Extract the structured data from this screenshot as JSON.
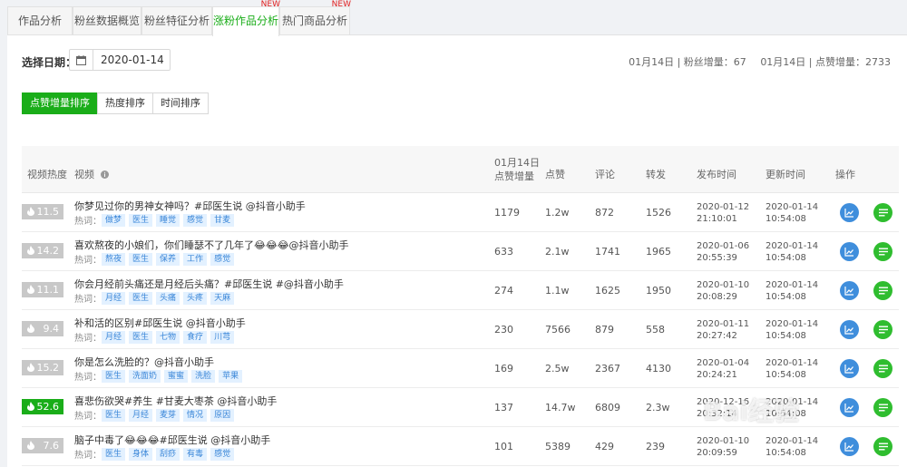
{
  "tabs": [
    {
      "label": "作品分析",
      "active": false,
      "badge": ""
    },
    {
      "label": "粉丝数据概览",
      "active": false,
      "badge": ""
    },
    {
      "label": "粉丝特征分析",
      "active": false,
      "badge": ""
    },
    {
      "label": "涨粉作品分析",
      "active": true,
      "badge": "NEW"
    },
    {
      "label": "热门商品分析",
      "active": false,
      "badge": "NEW"
    }
  ],
  "filter": {
    "date_label": "选择日期：",
    "date_value": "2020-01-14"
  },
  "stats": {
    "fans_gain": "01月14日 | 粉丝增量：67",
    "likes_gain": "01月14日 | 点赞增量：2733"
  },
  "sort_buttons": [
    {
      "label": "点赞增量排序",
      "active": true
    },
    {
      "label": "热度排序",
      "active": false
    },
    {
      "label": "时间排序",
      "active": false
    }
  ],
  "table": {
    "headers": {
      "heat": "视频热度",
      "video": "视频",
      "like_inc_date": "01月14日",
      "like_inc": "点赞增量",
      "likes": "点赞",
      "comments": "评论",
      "shares": "转发",
      "publish": "发布时间",
      "update": "更新时间",
      "ops": "操作"
    },
    "keyword_label": "热词：",
    "rows": [
      {
        "heat": "11.5",
        "hot": false,
        "title": "你梦见过你的男神女神吗？#邱医生说 @抖音小助手",
        "keywords": [
          "做梦",
          "医生",
          "睡觉",
          "感觉",
          "甘麦"
        ],
        "like_inc": "1179",
        "likes": "1.2w",
        "comments": "872",
        "shares": "1526",
        "publish_date": "2020-01-12",
        "publish_time": "21:10:01",
        "update_date": "2020-01-14",
        "update_time": "10:54:08"
      },
      {
        "heat": "14.2",
        "hot": false,
        "title": "喜欢熬夜的小娘们，你们睡瑟不了几年了😂😂😂@抖音小助手",
        "keywords": [
          "熬夜",
          "医生",
          "保养",
          "工作",
          "感觉"
        ],
        "like_inc": "633",
        "likes": "2.1w",
        "comments": "1741",
        "shares": "1965",
        "publish_date": "2020-01-06",
        "publish_time": "20:55:39",
        "update_date": "2020-01-14",
        "update_time": "10:54:08"
      },
      {
        "heat": "11.1",
        "hot": false,
        "title": "你会月经前头痛还是月经后头痛？#邱医生说 #@抖音小助手",
        "keywords": [
          "月经",
          "医生",
          "头痛",
          "头疼",
          "天麻"
        ],
        "like_inc": "274",
        "likes": "1.1w",
        "comments": "1625",
        "shares": "1950",
        "publish_date": "2020-01-10",
        "publish_time": "20:08:29",
        "update_date": "2020-01-14",
        "update_time": "10:54:08"
      },
      {
        "heat": "9.4",
        "hot": false,
        "title": "补和活的区别#邱医生说 @抖音小助手",
        "keywords": [
          "月经",
          "医生",
          "七物",
          "食疗",
          "川芎"
        ],
        "like_inc": "230",
        "likes": "7566",
        "comments": "879",
        "shares": "558",
        "publish_date": "2020-01-11",
        "publish_time": "20:27:42",
        "update_date": "2020-01-14",
        "update_time": "10:54:08"
      },
      {
        "heat": "15.2",
        "hot": false,
        "title": "你是怎么洗脸的？@抖音小助手",
        "keywords": [
          "医生",
          "洗面奶",
          "蜜蜜",
          "洗脸",
          "苹果"
        ],
        "like_inc": "169",
        "likes": "2.5w",
        "comments": "2367",
        "shares": "4130",
        "publish_date": "2020-01-04",
        "publish_time": "20:24:21",
        "update_date": "2020-01-14",
        "update_time": "10:54:08"
      },
      {
        "heat": "52.6",
        "hot": true,
        "title": "喜悲伤欲哭#养生 #甘麦大枣茶 @抖音小助手",
        "keywords": [
          "医生",
          "月经",
          "麦芽",
          "情况",
          "原因"
        ],
        "like_inc": "137",
        "likes": "14.7w",
        "comments": "6809",
        "shares": "2.3w",
        "publish_date": "2020-12-16",
        "publish_time": "20:32:14",
        "update_date": "2020-01-14",
        "update_time": "10:54:08"
      },
      {
        "heat": "7.6",
        "hot": false,
        "title": "脑子中毒了😂😂😂#邱医生说 @抖音小助手",
        "keywords": [
          "医生",
          "身体",
          "刮痧",
          "有毒",
          "感觉"
        ],
        "like_inc": "101",
        "likes": "5389",
        "comments": "429",
        "shares": "239",
        "publish_date": "2020-01-10",
        "publish_time": "20:09:59",
        "update_date": "2020-01-14",
        "update_time": "10:54:08"
      }
    ]
  },
  "icons": {
    "calendar": "calendar-icon",
    "info": "info-icon",
    "flame": "flame-icon",
    "chart": "line-chart-icon",
    "list": "list-icon"
  },
  "colors": {
    "accent": "#1aad19",
    "badge": "#e02020",
    "chart_button": "#3f8edc",
    "list_button": "#2fbd2f",
    "keyword_bg": "#e3f1ff",
    "keyword_text": "#3a86d8"
  },
  "watermark": "Bai经验"
}
